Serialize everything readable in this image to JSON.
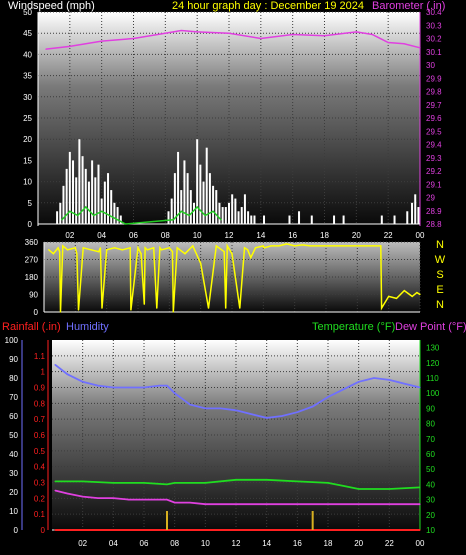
{
  "header": {
    "left_label": "Windspeed (mph)",
    "center_label": "24 hour graph day : December 19 2024",
    "right_label": "Barometer (.in)"
  },
  "colors": {
    "windspeed_label": "#ffffff",
    "title": "#ffff00",
    "barometer": "#e040e0",
    "wind_bars": "#ffffff",
    "gust": "#22cc22",
    "direction": "#ffff00",
    "rainfall": "#ff2020",
    "humidity": "#7070ff",
    "temperature": "#20dd20",
    "dewpoint": "#e040e0",
    "rain_bars": "#d8b020"
  },
  "x_axis": {
    "ticks": [
      2,
      4,
      6,
      8,
      10,
      12,
      14,
      16,
      18,
      20,
      22,
      0
    ],
    "tick_labels": [
      "02",
      "04",
      "06",
      "08",
      "10",
      "12",
      "14",
      "16",
      "18",
      "20",
      "22",
      "00"
    ]
  },
  "chart_data": [
    {
      "type": "bar",
      "name": "wind",
      "ylabel": "Windspeed (mph)",
      "ylim": [
        0,
        50
      ],
      "yticks": [
        0,
        5,
        10,
        15,
        20,
        25,
        30,
        35,
        40,
        45,
        50
      ],
      "y2label": "Barometer (.in)",
      "y2lim": [
        28.8,
        30.4
      ],
      "y2ticks": [
        "28.8",
        "28.9",
        "29",
        "29.1",
        "29.2",
        "29.3",
        "29.4",
        "29.5",
        "29.6",
        "29.7",
        "29.8",
        "29.9",
        "30",
        "30.1",
        "30.2",
        "30.3",
        "30.4"
      ],
      "barometer": {
        "x": [
          0.5,
          2,
          4,
          6,
          8,
          9,
          10,
          12,
          14,
          16,
          18,
          20,
          21,
          22,
          23,
          24
        ],
        "values": [
          30.12,
          30.14,
          30.18,
          30.2,
          30.24,
          30.26,
          30.25,
          30.24,
          30.2,
          30.23,
          30.22,
          30.25,
          30.23,
          30.17,
          30.16,
          30.13
        ]
      },
      "wind_bars": {
        "x": [
          1.2,
          1.4,
          1.6,
          1.8,
          2.0,
          2.2,
          2.4,
          2.6,
          2.8,
          3.0,
          3.2,
          3.4,
          3.6,
          3.8,
          4.0,
          4.2,
          4.4,
          4.6,
          4.8,
          5.0,
          5.2,
          8.2,
          8.4,
          8.6,
          8.8,
          9.0,
          9.2,
          9.4,
          9.6,
          9.8,
          10.0,
          10.2,
          10.4,
          10.6,
          10.8,
          11.0,
          11.2,
          11.4,
          11.6,
          11.8,
          12.0,
          12.2,
          12.4,
          12.6,
          12.8,
          13.0,
          13.2,
          13.4,
          13.6,
          14.2,
          15.8,
          16.4,
          17.2,
          18.6,
          19.2,
          21.6,
          22.4,
          23.2,
          23.5,
          23.7,
          23.9
        ],
        "values": [
          3,
          5,
          9,
          13,
          17,
          15,
          11,
          20,
          16,
          13,
          10,
          15,
          11,
          14,
          6,
          10,
          12,
          8,
          5,
          4,
          2,
          3,
          6,
          12,
          17,
          8,
          15,
          12,
          8,
          5,
          20,
          14,
          10,
          18,
          12,
          9,
          8,
          5,
          4,
          4,
          5,
          7,
          6,
          3,
          4,
          7,
          3,
          2,
          2,
          2,
          2,
          3,
          2,
          2,
          2,
          2,
          2,
          3,
          5,
          7,
          4
        ]
      },
      "gust_line": {
        "x": [
          1.5,
          2,
          2.5,
          3,
          3.5,
          4,
          4.5,
          5,
          5.5,
          8.5,
          9,
          9.5,
          10,
          10.5,
          11,
          11.5
        ],
        "values": [
          1,
          3,
          2,
          4,
          2,
          3,
          2,
          1,
          0,
          1,
          3,
          2,
          4,
          2,
          3,
          1
        ]
      }
    },
    {
      "type": "line",
      "name": "wind_direction",
      "ylim": [
        0,
        360
      ],
      "yticks": [
        0,
        90,
        180,
        270,
        360
      ],
      "right_labels": [
        "N",
        "W",
        "S",
        "E",
        "N"
      ],
      "x": [
        0.3,
        0.6,
        0.9,
        1.0,
        1.05,
        1.2,
        1.5,
        2.0,
        2.1,
        2.2,
        2.5,
        3.0,
        3.5,
        3.6,
        3.7,
        4.0,
        4.5,
        5.0,
        5.5,
        5.55,
        6.0,
        6.2,
        6.4,
        6.45,
        6.6,
        7.0,
        7.2,
        7.4,
        7.5,
        8.0,
        8.2,
        8.25,
        8.5,
        9.0,
        9.5,
        10.0,
        10.5,
        11.0,
        11.5,
        11.6,
        11.7,
        12.0,
        12.5,
        12.8,
        13.0,
        13.2,
        13.5,
        14.0,
        14.05,
        14.5,
        15.0,
        15.5,
        16.0,
        16.5,
        17.0,
        18.0,
        19.0,
        20.0,
        21.0,
        21.5,
        21.55,
        22.0,
        22.5,
        23.0,
        23.5,
        23.8,
        24.0
      ],
      "values": [
        320,
        300,
        330,
        310,
        0,
        340,
        320,
        330,
        300,
        10,
        330,
        320,
        310,
        330,
        20,
        320,
        330,
        320,
        330,
        10,
        330,
        300,
        40,
        330,
        320,
        330,
        20,
        330,
        320,
        330,
        310,
        0,
        330,
        300,
        340,
        250,
        20,
        340,
        310,
        20,
        340,
        300,
        20,
        330,
        320,
        280,
        330,
        340,
        330,
        340,
        340,
        350,
        340,
        345,
        340,
        340,
        340,
        340,
        340,
        340,
        20,
        80,
        70,
        110,
        80,
        100,
        90
      ]
    },
    {
      "type": "line",
      "name": "atmosphere",
      "y_humidity_lim": [
        0,
        100
      ],
      "y_humidity_ticks": [
        0,
        10,
        20,
        30,
        40,
        50,
        60,
        70,
        80,
        90,
        100
      ],
      "y_rain_lim": [
        0,
        1.2
      ],
      "y_rain_ticks": [
        "0",
        "0.1",
        "0.2",
        "0.3",
        "0.4",
        "0.5",
        "0.6",
        "0.7",
        "0.8",
        "0.9",
        "1",
        "1.1"
      ],
      "y_temp_lim": [
        10,
        135
      ],
      "y_temp_ticks": [
        10,
        20,
        30,
        40,
        50,
        60,
        70,
        80,
        90,
        100,
        110,
        120,
        130
      ],
      "series": [
        {
          "name": "Humidity",
          "x": [
            0.2,
            1,
            2,
            3,
            4,
            5,
            6,
            7,
            7.5,
            8,
            9,
            10,
            11,
            12,
            13,
            14,
            15,
            16,
            17,
            18,
            19,
            20,
            21,
            22,
            23,
            24
          ],
          "values": [
            87,
            82,
            78,
            76,
            75,
            75,
            75,
            76,
            76,
            72,
            66,
            64,
            64,
            63,
            61,
            59,
            60,
            62,
            65,
            70,
            74,
            78,
            80,
            79,
            77,
            75
          ]
        },
        {
          "name": "Temperature (°F)",
          "x": [
            0.2,
            2,
            4,
            6,
            7.5,
            8,
            10,
            12,
            14,
            16,
            18,
            19,
            20,
            22,
            24
          ],
          "values": [
            42,
            42,
            41,
            41,
            40,
            41,
            41,
            43,
            43,
            42,
            41,
            39,
            37,
            37,
            38
          ]
        },
        {
          "name": "Dew Point (°F)",
          "x": [
            0.2,
            1,
            2,
            3,
            4,
            5,
            6,
            7,
            7.5,
            8,
            9,
            10,
            11,
            12,
            14,
            16,
            18,
            20,
            22,
            24
          ],
          "values": [
            36,
            34,
            32,
            31,
            31,
            30,
            30,
            30,
            30,
            28,
            28,
            27,
            27,
            27,
            27,
            27,
            27,
            27,
            27,
            27
          ]
        },
        {
          "name": "Rainfall (.in)",
          "x": [
            0.2,
            24
          ],
          "values": [
            0,
            0
          ]
        }
      ],
      "rain_bars": {
        "x": [
          7.5,
          17
        ],
        "values": [
          0.12,
          0.12
        ]
      },
      "legend": {
        "rainfall": "Rainfall (.in)",
        "humidity": "Humidity",
        "temperature": "Temperature (°F)",
        "dewpoint": "Dew Point (°F)"
      }
    }
  ]
}
